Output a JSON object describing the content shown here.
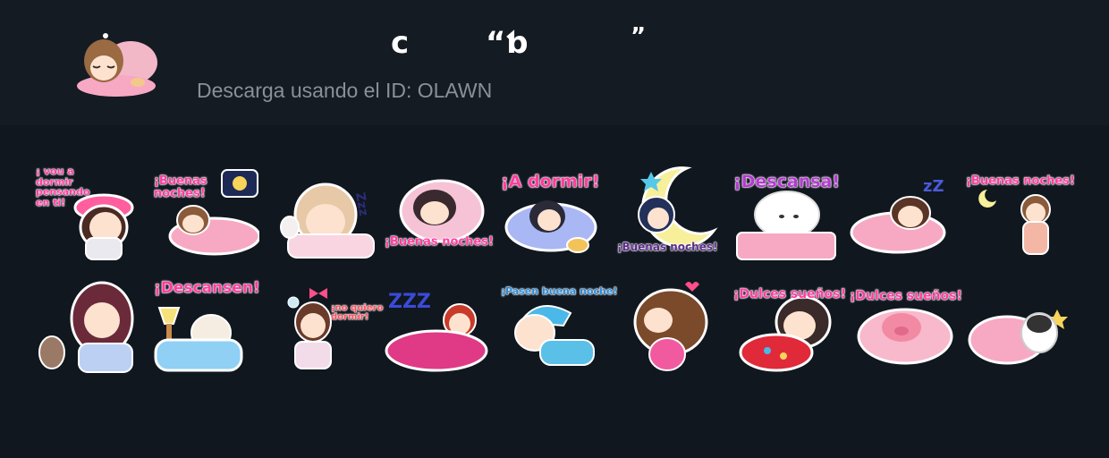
{
  "header": {
    "title_glyphs": [
      "c",
      "“ƅ",
      "”"
    ],
    "subtitle": "Descarga usando el ID: OLAWN",
    "pack_icon": "girl-sleeping-on-pillow-icon"
  },
  "stickers": [
    {
      "caption": "¡ vou a\ndormir\npensando\nen ti!",
      "icon": "girl-hugging-pillow-sticker"
    },
    {
      "caption": "¡Buenas\nnoches!",
      "icon": "girl-in-bed-moon-sticker"
    },
    {
      "caption": "",
      "icon": "girl-with-bunny-sticker"
    },
    {
      "caption": "¡Buenas noches!",
      "icon": "girl-on-pink-pillow-sticker"
    },
    {
      "caption": "¡A dormir!",
      "icon": "girl-yawning-with-cat-sticker"
    },
    {
      "caption": "¡Buenas noches!",
      "icon": "girl-on-moon-sticker"
    },
    {
      "caption": "¡Descansa!",
      "icon": "white-bear-in-bed-sticker"
    },
    {
      "caption": "",
      "icon": "girl-sleeping-zzz-sticker"
    },
    {
      "caption": "¡Buenas noches!",
      "icon": "girl-yawning-stars-sticker"
    },
    {
      "caption": "",
      "icon": "girl-with-teddy-bear-sticker"
    },
    {
      "caption": "¡Descansen!",
      "icon": "bunny-in-bed-lamp-sticker"
    },
    {
      "caption": "¡no quiero\ndormir!",
      "icon": "girl-crying-pillow-sticker"
    },
    {
      "caption": "",
      "icon": "girl-under-blanket-zzz-sticker"
    },
    {
      "caption": "¡Pasen buena noche!",
      "icon": "boy-sleeping-nightcap-sticker"
    },
    {
      "caption": "",
      "icon": "girl-hugging-pillow-heart-sticker"
    },
    {
      "caption": "¡Dulces sueños!",
      "icon": "girl-under-flower-blanket-sticker"
    },
    {
      "caption": "¡Dulces sueños!",
      "icon": "pig-in-bed-sticker"
    },
    {
      "caption": "",
      "icon": "penguin-sleeping-sticker"
    }
  ],
  "colors": {
    "header_bg": "#141b23",
    "body_bg": "#10171e",
    "caption_pink": "#ff3da0",
    "subtitle_gray": "#8a9096"
  }
}
